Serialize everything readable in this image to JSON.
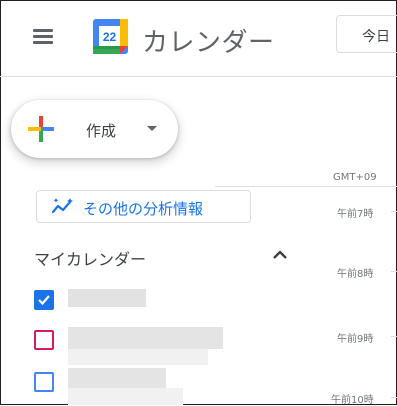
{
  "header": {
    "app_title": "カレンダー",
    "logo_day": "22",
    "today_label": "今日"
  },
  "create": {
    "label": "作成"
  },
  "insights": {
    "label": "その他の分析情報"
  },
  "timezone": {
    "label": "GMT+09"
  },
  "times": [
    "午前7時",
    "午前8時",
    "午前9時",
    "午前10時"
  ],
  "my_calendars": {
    "title": "マイカレンダー",
    "items": [
      {
        "checked": true,
        "color": "#1a73e8"
      },
      {
        "checked": false,
        "color": "#d81b60"
      },
      {
        "checked": false,
        "color": "#4285f4"
      }
    ]
  },
  "colors": {
    "accent": "#1a73e8",
    "logo_blue": "#4285f4",
    "logo_green": "#34a853",
    "logo_yellow": "#fbbc04",
    "logo_red": "#ea4335"
  }
}
